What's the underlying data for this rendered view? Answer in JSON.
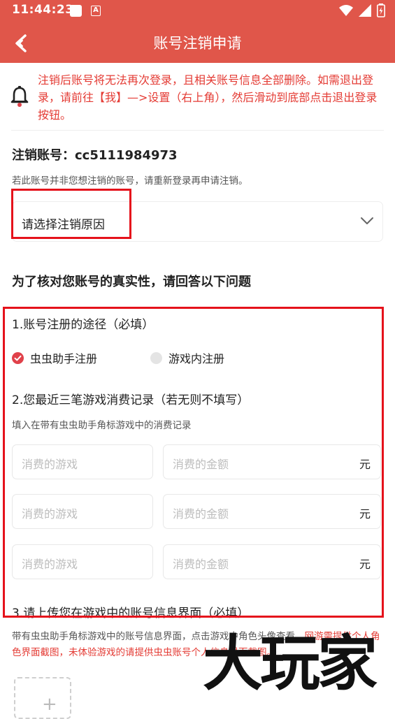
{
  "status": {
    "time": "11:44:23",
    "app_icon_letter": "A"
  },
  "header": {
    "title": "账号注销申请"
  },
  "notice": {
    "text": "注销后账号将无法再次登录，且相关账号信息全部删除。如需退出登录，请前往【我】—>设置（右上角），然后滑动到底部点击退出登录按钮。"
  },
  "account": {
    "label": "注销账号：",
    "id": "cc5111984973",
    "tip": "若此账号并非您想注销的账号，请重新登录再申请注销。"
  },
  "reason": {
    "placeholder": "请选择注销原因"
  },
  "verify": {
    "title": "为了核对您账号的真实性，请回答以下问题",
    "q1": {
      "label": "1.账号注册的途径（必填）",
      "options": [
        {
          "label": "虫虫助手注册",
          "selected": true
        },
        {
          "label": "游戏内注册",
          "selected": false
        }
      ]
    },
    "q2": {
      "label": "2.您最近三笔游戏消费记录（若无则不填写）",
      "tip": "填入在带有虫虫助手角标游戏中的消费记录",
      "rows": [
        {
          "game_placeholder": "消费的游戏",
          "amount_placeholder": "消费的金额",
          "unit": "元"
        },
        {
          "game_placeholder": "消费的游戏",
          "amount_placeholder": "消费的金额",
          "unit": "元"
        },
        {
          "game_placeholder": "消费的游戏",
          "amount_placeholder": "消费的金额",
          "unit": "元"
        }
      ]
    },
    "q3": {
      "label": "3.请上传您在游戏中的账号信息界面（必填）",
      "tip_normal": "带有虫虫助手角标游戏中的账号信息界面，点击游戏中角色头像查看。",
      "tip_red": "网游需提供个人角色界面截图，未体验游戏的请提供虫虫账号个人信息界面截图。"
    }
  },
  "upload": {
    "plus": "+"
  },
  "watermark": {
    "text": "大玩家"
  },
  "colors": {
    "brand": "#e0564a",
    "warning": "#e43b34",
    "highlight_box": "#e5121b"
  }
}
